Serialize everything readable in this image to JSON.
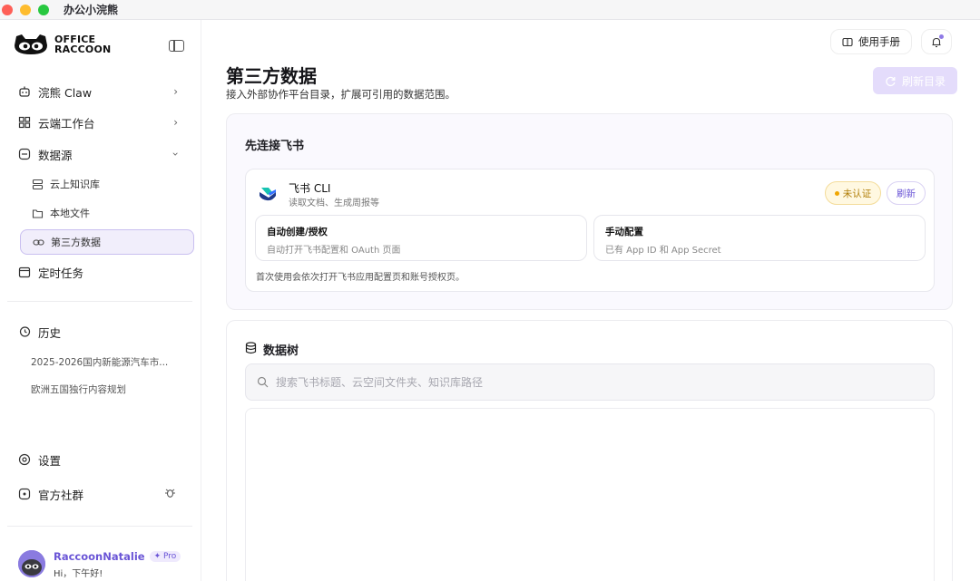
{
  "window": {
    "title": "办公小浣熊"
  },
  "sidebar": {
    "logo_line1": "OFFICE",
    "logo_line2": "RACCOON",
    "nav": [
      {
        "label": "浣熊 Claw"
      },
      {
        "label": "云端工作台"
      },
      {
        "label": "数据源"
      },
      {
        "label": "定时任务"
      }
    ],
    "datasource_items": [
      {
        "label": "云上知识库"
      },
      {
        "label": "本地文件"
      },
      {
        "label": "第三方数据"
      }
    ],
    "history_title": "历史",
    "history": [
      {
        "label": "2025-2026国内新能源汽车市..."
      },
      {
        "label": "欧洲五国独行内容规划"
      }
    ],
    "settings_label": "设置",
    "community_label": "官方社群",
    "user": {
      "name": "RaccoonNatalie",
      "badge": "Pro",
      "greeting": "Hi，下午好!"
    }
  },
  "header": {
    "manual_label": "使用手册"
  },
  "main": {
    "title": "第三方数据",
    "subtitle": "接入外部协作平台目录，扩展可引用的数据范围。",
    "refresh_dir_label": "刷新目录",
    "feishu_card": {
      "title": "先连接飞书",
      "name": "飞书 CLI",
      "desc": "读取文档、生成周报等",
      "status": "未认证",
      "refresh_label": "刷新",
      "auto_title": "自动创建/授权",
      "auto_desc": "自动打开飞书配置和 OAuth 页面",
      "manual_title": "手动配置",
      "manual_desc": "已有 App ID 和 App Secret",
      "note": "首次使用会依次打开飞书应用配置页和账号授权页。"
    },
    "tree_card": {
      "title": "数据树",
      "search_placeholder": "搜索飞书标题、云空间文件夹、知识库路径"
    }
  },
  "colors": {
    "accent": "#6a55d6",
    "active_bg": "#f1eefb",
    "status_warn": "#f0a600"
  }
}
